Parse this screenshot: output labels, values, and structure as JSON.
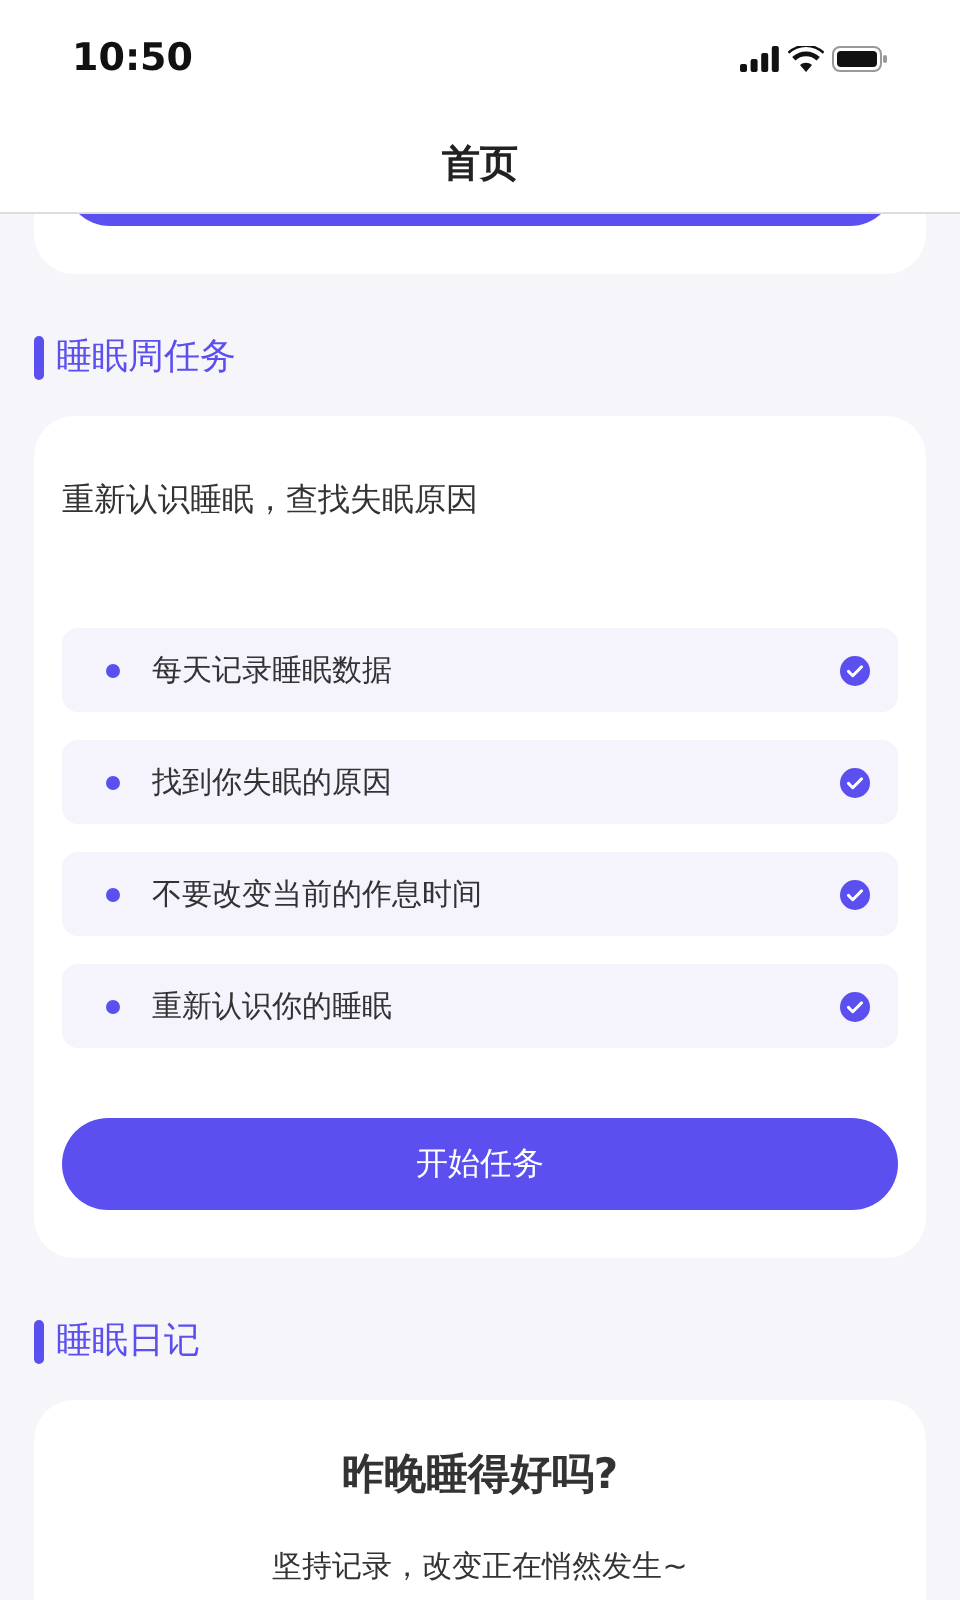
{
  "status_bar": {
    "time": "10:50"
  },
  "header": {
    "title": "首页"
  },
  "weekly_task": {
    "section_title": "睡眠周任务",
    "subtitle": "重新认识睡眠，查找失眠原因",
    "items": [
      {
        "label": "每天记录睡眠数据",
        "checked": true
      },
      {
        "label": "找到你失眠的原因",
        "checked": true
      },
      {
        "label": "不要改变当前的作息时间",
        "checked": true
      },
      {
        "label": "重新认识你的睡眠",
        "checked": true
      }
    ],
    "button": "开始任务"
  },
  "diary": {
    "section_title": "睡眠日记",
    "question": "昨晚睡得好吗?",
    "hint": "坚持记录，改变正在悄然发生~"
  }
}
